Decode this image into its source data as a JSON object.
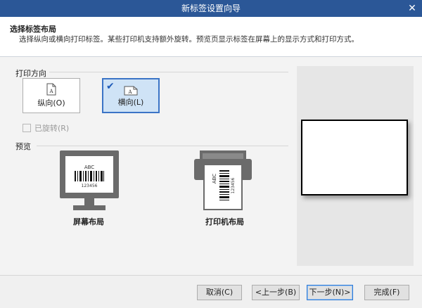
{
  "window": {
    "title": "新标签设置向导",
    "close_glyph": "✕"
  },
  "header": {
    "title": "选择标签布局",
    "description": "选择纵向或横向打印标签。某些打印机支持额外旋转。预览页显示标签在屏幕上的显示方式和打印方式。"
  },
  "orientation": {
    "section_label": "打印方向",
    "portrait_label": "纵向(O)",
    "landscape_label": "横向(L)",
    "selected": "landscape",
    "check_glyph": "✔",
    "doc_letter": "A"
  },
  "rotated": {
    "label": "已旋转(R)",
    "checked": false,
    "enabled": false
  },
  "preview": {
    "section_label": "预览",
    "screen_layout_label": "屏幕布局",
    "printer_layout_label": "打印机布局",
    "barcode_text": "ABC",
    "barcode_number": "123456"
  },
  "buttons": {
    "cancel": "取消(C)",
    "back": "<上一步(B)",
    "next": "下一步(N)>",
    "finish": "完成(F)"
  },
  "colors": {
    "titlebar": "#2b5797",
    "selected_fill": "#cfe3f6",
    "selected_border": "#3b74c6",
    "icon_gray": "#6b6b6b"
  },
  "icons": [
    "close-icon",
    "checkmark-icon",
    "portrait-doc-icon",
    "landscape-doc-icon",
    "monitor-icon",
    "printer-icon",
    "barcode-icon"
  ]
}
